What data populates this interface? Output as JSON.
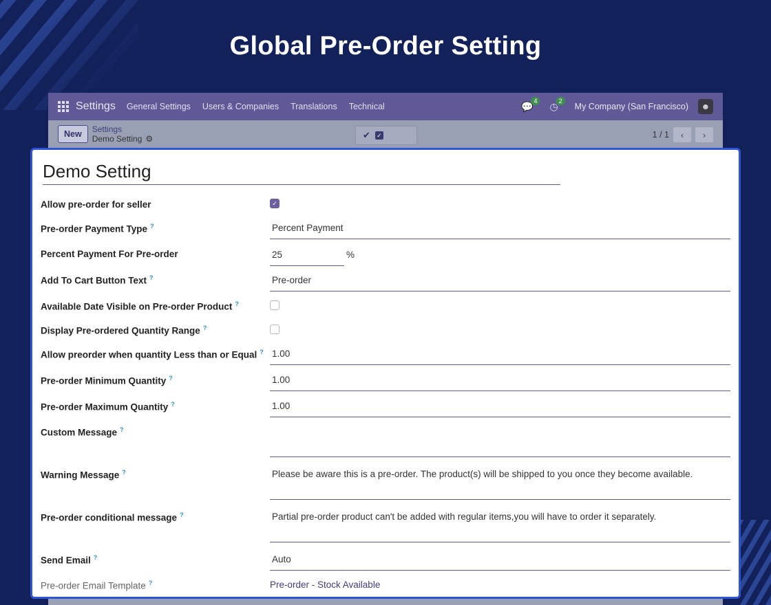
{
  "hero": {
    "title": "Global Pre-Order Setting"
  },
  "navbar": {
    "brand": "Settings",
    "items": [
      "General Settings",
      "Users & Companies",
      "Translations",
      "Technical"
    ],
    "messages_count": "4",
    "activities_count": "2",
    "company": "My Company (San Francisco)"
  },
  "control": {
    "new_label": "New",
    "breadcrumb_parent": "Settings",
    "breadcrumb_current": "Demo Setting",
    "pager": "1 / 1"
  },
  "form": {
    "record_name": "Demo Setting",
    "fields": {
      "allow_preorder_seller": {
        "label": "Allow pre-order for seller",
        "checked": true
      },
      "payment_type": {
        "label": "Pre-order Payment Type",
        "help": "?",
        "value": "Percent Payment"
      },
      "percent_payment": {
        "label": "Percent Payment For Pre-order",
        "value": "25",
        "unit": "%"
      },
      "cart_button_text": {
        "label": "Add To Cart Button Text",
        "help": "?",
        "value": "Pre-order"
      },
      "available_date_visible": {
        "label": "Available Date Visible on Pre-order Product",
        "help": "?",
        "checked": false
      },
      "display_qty_range": {
        "label": "Display Pre-ordered Quantity Range",
        "help": "?",
        "checked": false
      },
      "allow_when_qty_le": {
        "label": "Allow preorder when quantity Less than or Equal",
        "help": "?",
        "value": "1.00"
      },
      "min_qty": {
        "label": "Pre-order Minimum Quantity",
        "help": "?",
        "value": "1.00"
      },
      "max_qty": {
        "label": "Pre-order Maximum Quantity",
        "help": "?",
        "value": "1.00"
      },
      "custom_message": {
        "label": "Custom Message",
        "help": "?",
        "value": ""
      },
      "warning_message": {
        "label": "Warning Message",
        "help": "?",
        "value": "Please be aware this is a pre-order. The product(s) will be shipped to you once they become available."
      },
      "conditional_message": {
        "label": "Pre-order conditional message",
        "help": "?",
        "value": "Partial pre-order product can't be added with regular items,you will have to order it separately."
      },
      "send_email": {
        "label": "Send Email",
        "help": "?",
        "value": "Auto"
      },
      "email_template": {
        "label": "Pre-order Email Template",
        "help": "?",
        "value": "Pre-order - Stock Available"
      }
    }
  },
  "colors": {
    "background": "#13215a",
    "navbar": "#5f5a97",
    "accent_border": "#2f55d4",
    "checkbox_checked": "#6d5e9e"
  }
}
